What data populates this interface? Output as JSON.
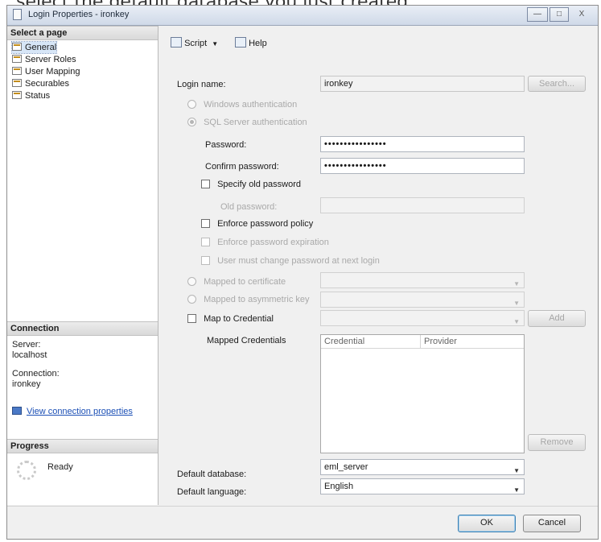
{
  "page_top_text": "select the default database you just created.",
  "window": {
    "title": "Login Properties - ironkey",
    "minimize_glyph": "—",
    "maximize_glyph": "□",
    "close_glyph": "X"
  },
  "left_pane": {
    "select_page_header": "Select a page",
    "pages": [
      "General",
      "Server Roles",
      "User Mapping",
      "Securables",
      "Status"
    ],
    "connection_header": "Connection",
    "server_label": "Server:",
    "server_value": "localhost",
    "connection_label": "Connection:",
    "connection_value": "ironkey",
    "view_properties_link": "View connection properties",
    "progress_header": "Progress",
    "progress_status": "Ready"
  },
  "toolbar": {
    "script_label": "Script",
    "help_label": "Help"
  },
  "form": {
    "login_name_label": "Login name:",
    "login_name_value": "ironkey",
    "search_button": "Search...",
    "windows_auth": "Windows authentication",
    "sql_auth": "SQL Server authentication",
    "password_label": "Password:",
    "password_value": "••••••••••••••••",
    "confirm_password_label": "Confirm password:",
    "confirm_password_value": "••••••••••••••••",
    "specify_old_password": "Specify old password",
    "old_password_label": "Old password:",
    "enforce_policy": "Enforce password policy",
    "enforce_expiration": "Enforce password expiration",
    "must_change": "User must change password at next login",
    "mapped_certificate": "Mapped to certificate",
    "mapped_asym_key": "Mapped to asymmetric key",
    "map_credential": "Map to Credential",
    "add_button": "Add",
    "mapped_credentials_label": "Mapped Credentials",
    "credential_col": "Credential",
    "provider_col": "Provider",
    "remove_button": "Remove",
    "default_database_label": "Default database:",
    "default_database_value": "eml_server",
    "default_language_label": "Default language:",
    "default_language_value": "English"
  },
  "buttons": {
    "ok": "OK",
    "cancel": "Cancel"
  }
}
